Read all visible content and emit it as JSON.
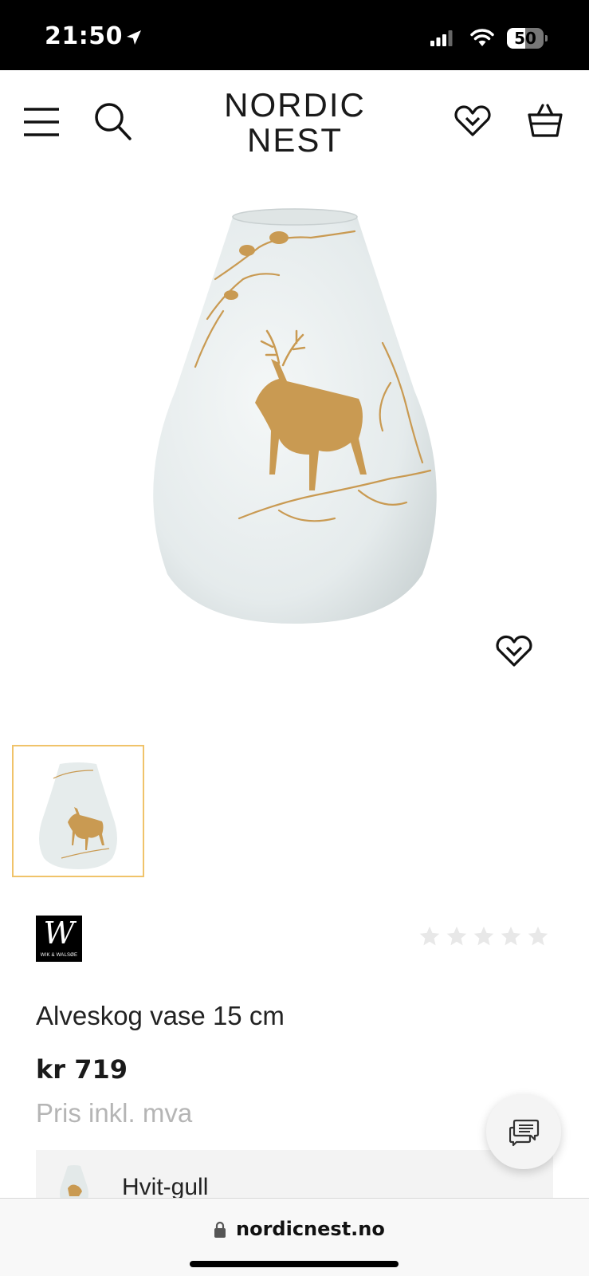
{
  "status_bar": {
    "time": "21:50",
    "battery": "50",
    "battery_level": 0.5,
    "icons": [
      "location-arrow-icon",
      "signal-icon",
      "wifi-icon",
      "battery-icon"
    ]
  },
  "header": {
    "logo_line1": "NORDIC",
    "logo_line2": "NEST",
    "icons": [
      "menu-icon",
      "search-icon",
      "wishlist-heart-icon",
      "shopping-basket-icon"
    ]
  },
  "product": {
    "brand_mark": "W",
    "brand_name": "WIK & WALSØE",
    "rating_stars_filled": 0,
    "rating_stars_total": 5,
    "title": "Alveskog vase 15 cm",
    "price": "kr 719",
    "price_note": "Pris inkl. mva",
    "variant_label": "Hvit-gull"
  },
  "browser": {
    "url": "nordicnest.no"
  },
  "colors": {
    "accent_border": "#f0c36a",
    "gold": "#c99a52",
    "vase": "#e9eeee"
  }
}
